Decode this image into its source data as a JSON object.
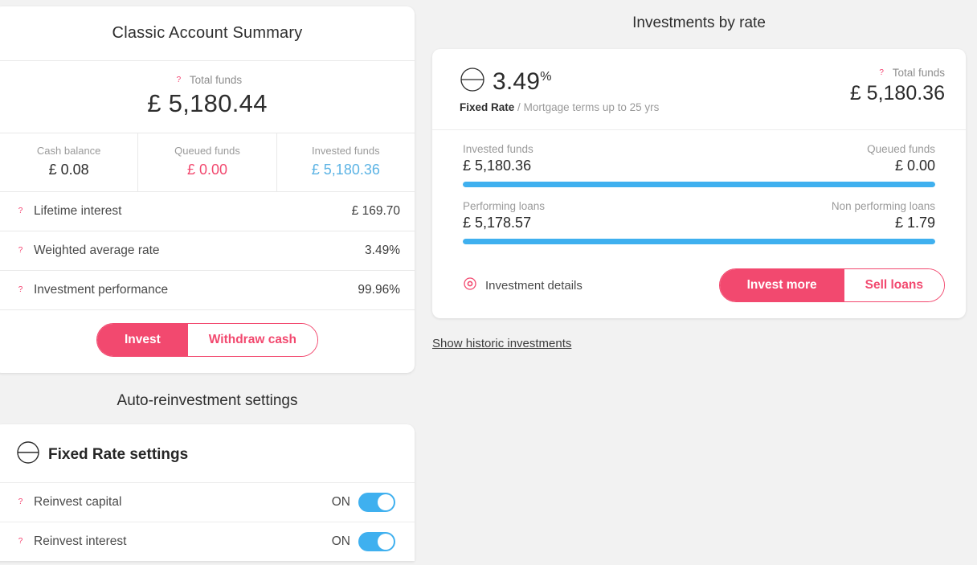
{
  "theme": {
    "background": "#f2f2f2",
    "accent_pink": "#f2496f",
    "accent_blue": "#3fb0ef",
    "value_blue": "#5bb3e4",
    "text_dark": "#2e2e2e",
    "text_muted": "#9a9a9a"
  },
  "summary": {
    "title": "Classic Account Summary",
    "total_label": "Total funds",
    "total_value": "£ 5,180.44",
    "help_icon": "question-circle-icon",
    "columns": [
      {
        "label": "Cash balance",
        "value": "£ 0.08",
        "tone": "dark"
      },
      {
        "label": "Queued funds",
        "value": "£ 0.00",
        "tone": "pink"
      },
      {
        "label": "Invested funds",
        "value": "£ 5,180.36",
        "tone": "blue"
      }
    ],
    "rows": [
      {
        "label": "Lifetime interest",
        "value": "£ 169.70"
      },
      {
        "label": "Weighted average rate",
        "value": "3.49%"
      },
      {
        "label": "Investment performance",
        "value": "99.96%"
      }
    ],
    "primary_button": "Invest",
    "secondary_button": "Withdraw cash"
  },
  "reinvest": {
    "section_title": "Auto-reinvestment settings",
    "card_title": "Fixed Rate settings",
    "rate_icon": "circle-line-icon",
    "toggles": [
      {
        "label": "Reinvest capital",
        "state": "ON"
      },
      {
        "label": "Reinvest interest",
        "state": "ON"
      }
    ]
  },
  "investments": {
    "title": "Investments by rate",
    "rate_icon": "circle-line-icon",
    "rate_value": "3.49",
    "rate_unit": "%",
    "product_name": "Fixed Rate",
    "product_separator": "/",
    "product_terms": "Mortgage terms up to 25 yrs",
    "total_label": "Total funds",
    "total_value": "£ 5,180.36",
    "bars": [
      {
        "left_label": "Invested funds",
        "left_value": "£ 5,180.36",
        "right_label": "Queued funds",
        "right_value": "£ 0.00",
        "fill_percent": 100
      },
      {
        "left_label": "Performing loans",
        "left_value": "£ 5,178.57",
        "right_label": "Non performing loans",
        "right_value": "£ 1.79",
        "fill_percent": 100
      }
    ],
    "details_label": "Investment details",
    "details_icon": "eye-icon",
    "primary_button": "Invest more",
    "secondary_button": "Sell loans",
    "historic_link": "Show historic investments"
  }
}
